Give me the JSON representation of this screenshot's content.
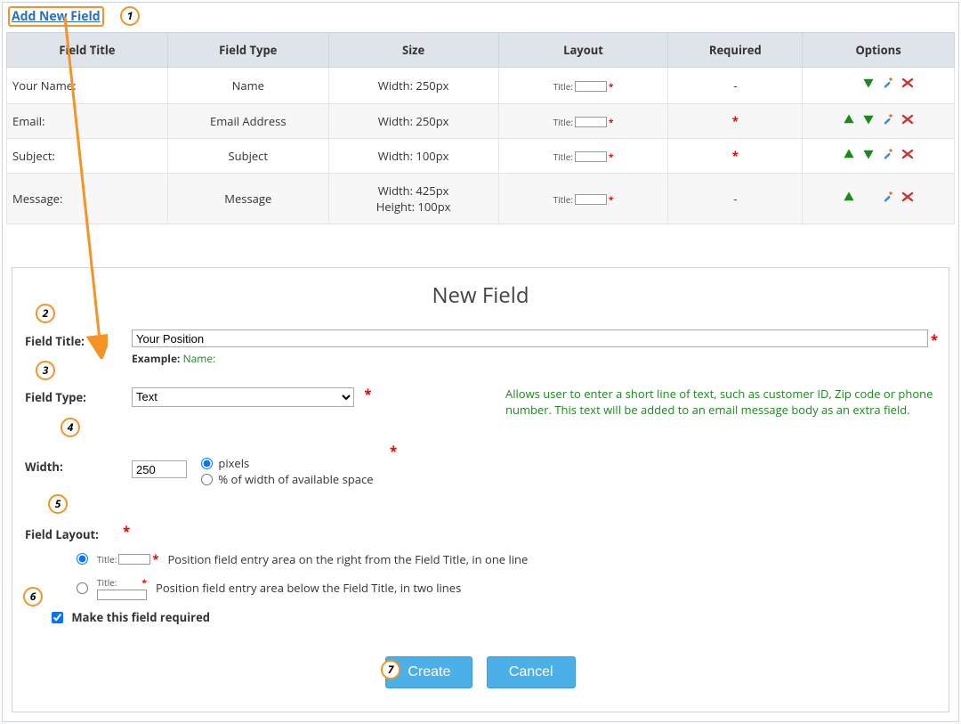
{
  "addLinkLabel": "Add New Field",
  "headers": {
    "title": "Field Title",
    "type": "Field Type",
    "size": "Size",
    "layout": "Layout",
    "required": "Required",
    "options": "Options"
  },
  "rows": [
    {
      "title": "Your Name:",
      "type": "Name",
      "size": "Width:  250px",
      "required": "-"
    },
    {
      "title": "Email:",
      "type": "Email Address",
      "size": "Width:  250px",
      "required": "*"
    },
    {
      "title": "Subject:",
      "type": "Subject",
      "size": "Width:  100px",
      "required": "*"
    },
    {
      "title": "Message:",
      "type": "Message",
      "size": "Width:  425px\nHeight: 100px",
      "required": "-"
    }
  ],
  "layoutDemoLabel": "Title:",
  "panel": {
    "heading": "New Field",
    "fieldTitle": {
      "label": "Field Title:",
      "value": "Your Position",
      "hintKey": "Example:",
      "hintVal": "Name:"
    },
    "fieldType": {
      "label": "Field Type:",
      "value": "Text",
      "desc": "Allows user to enter a short line of text, such as customer ID, Zip code or phone number. This text will be added to an email message body as an extra field."
    },
    "width": {
      "label": "Width:",
      "value": "250",
      "opt1": "pixels",
      "opt2": "% of width of available space"
    },
    "layout": {
      "label": "Field Layout:",
      "optA": "Position field entry area on the right from the Field Title, in one line",
      "optB": "Position field entry area below the Field Title, in two lines"
    },
    "requiredChk": "Make this field required",
    "create": "Create",
    "cancel": "Cancel"
  }
}
